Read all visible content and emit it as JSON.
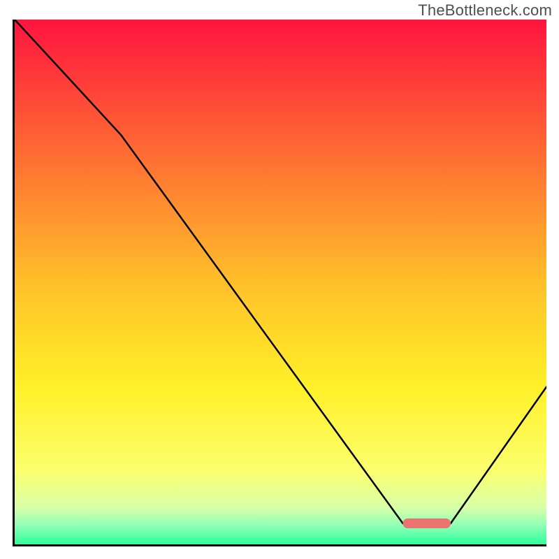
{
  "watermark": "TheBottleneck.com",
  "chart_data": {
    "type": "line",
    "title": "",
    "xlabel": "",
    "ylabel": "",
    "xlim": [
      0,
      100
    ],
    "ylim": [
      0,
      100
    ],
    "x": [
      0,
      20,
      73,
      78,
      82,
      100
    ],
    "values": [
      100,
      78,
      4,
      4,
      4,
      30
    ],
    "gradient_stops": [
      {
        "offset": 0.0,
        "color": "#ff143f"
      },
      {
        "offset": 0.25,
        "color": "#ff6a33"
      },
      {
        "offset": 0.5,
        "color": "#ffbf2a"
      },
      {
        "offset": 0.7,
        "color": "#fff028"
      },
      {
        "offset": 0.86,
        "color": "#fcff6e"
      },
      {
        "offset": 0.93,
        "color": "#d8ffa8"
      },
      {
        "offset": 0.965,
        "color": "#8effb5"
      },
      {
        "offset": 1.0,
        "color": "#2dff9e"
      }
    ],
    "marker": {
      "x_start": 73,
      "x_end": 82,
      "y": 4,
      "color": "#e9736e"
    }
  }
}
